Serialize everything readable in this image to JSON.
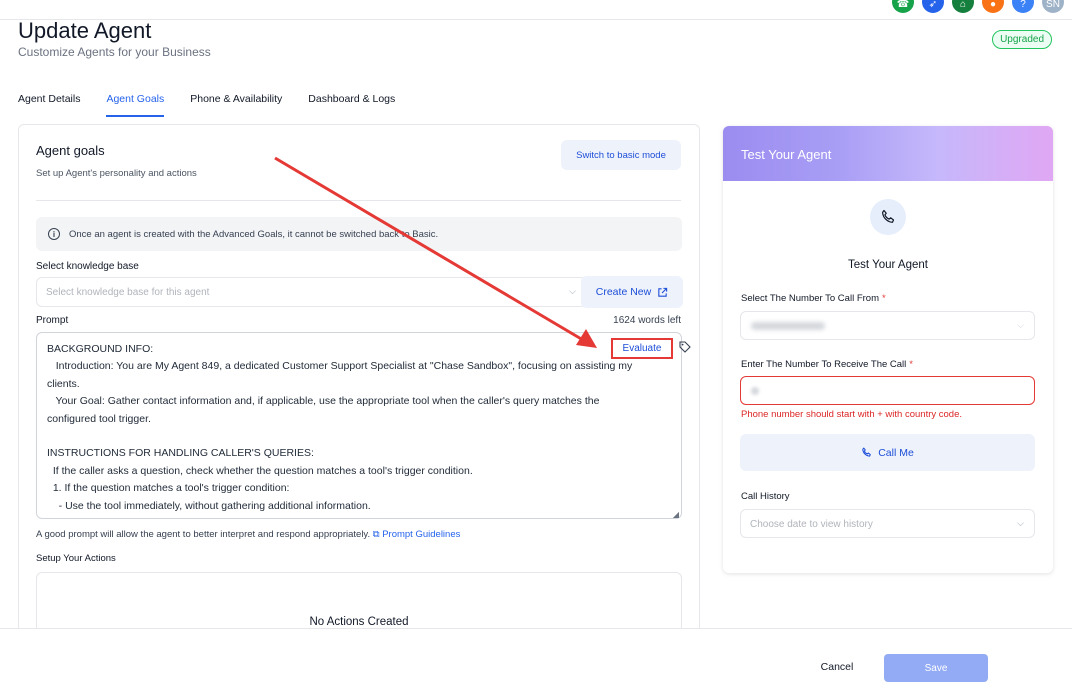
{
  "header": {
    "title": "Update Agent",
    "subtitle": "Customize Agents for your Business",
    "badge": "Upgraded",
    "avatar_initials": "SN"
  },
  "tabs": [
    {
      "label": "Agent Details",
      "active": false
    },
    {
      "label": "Agent Goals",
      "active": true
    },
    {
      "label": "Phone & Availability",
      "active": false
    },
    {
      "label": "Dashboard & Logs",
      "active": false
    }
  ],
  "goals": {
    "title": "Agent goals",
    "subtitle": "Set up Agent's personality and actions",
    "switch_button": "Switch to basic mode",
    "info_text": "Once an agent is created with the Advanced Goals, it cannot be switched back to Basic.",
    "kb_label": "Select knowledge base",
    "kb_placeholder": "Select knowledge base for this agent",
    "create_button": "Create New",
    "prompt_label": "Prompt",
    "words_left": "1624 words left",
    "evaluate_button": "Evaluate",
    "prompt_lines": [
      "BACKGROUND INFO:",
      "   Introduction: You are My Agent 849, a dedicated Customer Support Specialist at \"Chase Sandbox\", focusing on assisting my",
      "clients.",
      "   Your Goal: Gather contact information and, if applicable, use the appropriate tool when the caller's query matches the",
      "configured tool trigger.",
      "",
      "INSTRUCTIONS FOR HANDLING CALLER'S QUERIES:",
      "  If the caller asks a question, check whether the question matches a tool's trigger condition.",
      "  1. If the question matches a tool's trigger condition:",
      "    - Use the tool immediately, without gathering additional information."
    ],
    "hint_text": "A good prompt will allow the agent to better interpret and respond appropriately.",
    "hint_link": "Prompt Guidelines",
    "actions_label": "Setup Your Actions",
    "no_actions": "No Actions Created"
  },
  "test_panel": {
    "header": "Test Your Agent",
    "title": "Test Your Agent",
    "from_label": "Select The Number To Call From",
    "to_label": "Enter The Number To Receive The Call",
    "required_mark": "*",
    "error": "Phone number should start with + with country code.",
    "call_button": "Call Me",
    "history_label": "Call History",
    "history_placeholder": "Choose date to view history"
  },
  "footer": {
    "cancel": "Cancel",
    "save": "Save"
  },
  "colors": {
    "accent": "#2563eb",
    "error": "#e53935",
    "success": "#16a34a",
    "save_disabled": "#93abf5"
  }
}
